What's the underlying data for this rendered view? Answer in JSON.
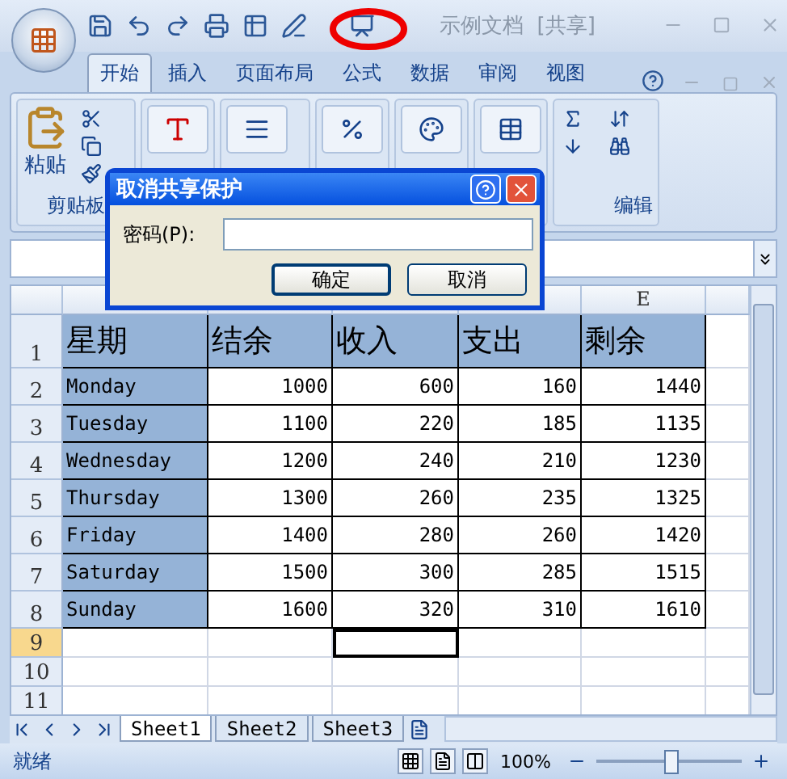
{
  "title_bar": {
    "title": "示例文档  [共享]"
  },
  "ribbon_tabs": [
    {
      "label": "开始",
      "selected": true
    },
    {
      "label": "插入",
      "selected": false
    },
    {
      "label": "页面布局",
      "selected": false
    },
    {
      "label": "公式",
      "selected": false
    },
    {
      "label": "数据",
      "selected": false
    },
    {
      "label": "审阅",
      "selected": false
    },
    {
      "label": "视图",
      "selected": false
    }
  ],
  "ribbon": {
    "paste_label": "粘贴",
    "clipboard_group": "剪贴板",
    "editing_group": "编辑"
  },
  "column_header": "E",
  "rows": [
    {
      "number": "1",
      "kind": "header",
      "selected": false,
      "cells": [
        {
          "text": "星期"
        },
        {
          "text": "结余"
        },
        {
          "text": "收入"
        },
        {
          "text": "支出"
        },
        {
          "text": "剩余"
        }
      ]
    },
    {
      "number": "2",
      "kind": "data",
      "selected": false,
      "cells": [
        {
          "text": "Monday"
        },
        {
          "text": "1000"
        },
        {
          "text": "600"
        },
        {
          "text": "160"
        },
        {
          "text": "1440"
        }
      ]
    },
    {
      "number": "3",
      "kind": "data",
      "selected": false,
      "cells": [
        {
          "text": "Tuesday"
        },
        {
          "text": "1100"
        },
        {
          "text": "220"
        },
        {
          "text": "185"
        },
        {
          "text": "1135"
        }
      ]
    },
    {
      "number": "4",
      "kind": "data",
      "selected": false,
      "cells": [
        {
          "text": "Wednesday"
        },
        {
          "text": "1200"
        },
        {
          "text": "240"
        },
        {
          "text": "210"
        },
        {
          "text": "1230"
        }
      ]
    },
    {
      "number": "5",
      "kind": "data",
      "selected": false,
      "cells": [
        {
          "text": "Thursday"
        },
        {
          "text": "1300"
        },
        {
          "text": "260"
        },
        {
          "text": "235"
        },
        {
          "text": "1325"
        }
      ]
    },
    {
      "number": "6",
      "kind": "data",
      "selected": false,
      "cells": [
        {
          "text": "Friday"
        },
        {
          "text": "1400"
        },
        {
          "text": "280"
        },
        {
          "text": "260"
        },
        {
          "text": "1420"
        }
      ]
    },
    {
      "number": "7",
      "kind": "data",
      "selected": false,
      "cells": [
        {
          "text": "Saturday"
        },
        {
          "text": "1500"
        },
        {
          "text": "300"
        },
        {
          "text": "285"
        },
        {
          "text": "1515"
        }
      ]
    },
    {
      "number": "8",
      "kind": "data",
      "selected": false,
      "cells": [
        {
          "text": "Sunday"
        },
        {
          "text": "1600"
        },
        {
          "text": "320"
        },
        {
          "text": "310"
        },
        {
          "text": "1610"
        }
      ]
    },
    {
      "number": "9",
      "kind": "empty",
      "selected": true,
      "cells": [
        {
          "selected": false
        },
        {
          "selected": false
        },
        {
          "selected": true
        },
        {
          "selected": false
        },
        {
          "selected": false
        }
      ]
    },
    {
      "number": "10",
      "kind": "empty",
      "selected": false
    },
    {
      "number": "11",
      "kind": "empty",
      "selected": false
    }
  ],
  "sheet_tabs": [
    {
      "label": "Sheet1",
      "selected": true
    },
    {
      "label": "Sheet2",
      "selected": false
    },
    {
      "label": "Sheet3",
      "selected": false
    }
  ],
  "status_bar": {
    "status": "就绪",
    "zoom": "100%",
    "zoom_level": {
      "level": 0.5
    }
  },
  "dialog": {
    "title": "取消共享保护",
    "password_label": "密码(P):",
    "buttons": [
      "确定",
      "取消"
    ]
  }
}
